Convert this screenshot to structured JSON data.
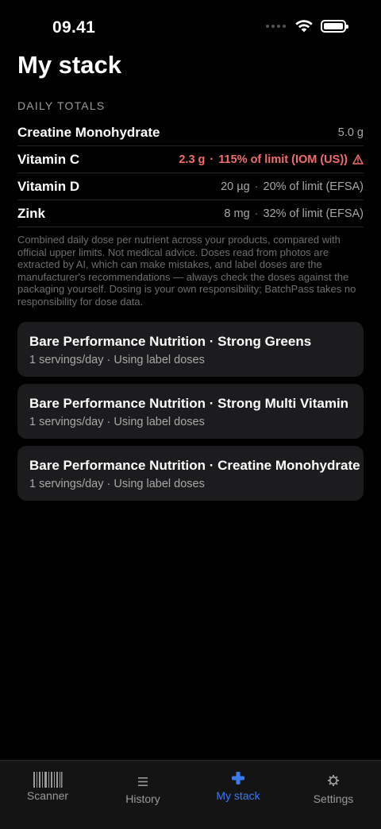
{
  "status_bar": {
    "time": "09.41"
  },
  "page": {
    "title": "My stack"
  },
  "daily_totals": {
    "label": "DAILY TOTALS",
    "rows": [
      {
        "name": "Creatine Monohydrate",
        "amount": "5.0 g",
        "limit": "",
        "over": false
      },
      {
        "name": "Vitamin C",
        "amount": "2.3 g",
        "limit": "115% of limit (IOM (US))",
        "over": true
      },
      {
        "name": "Vitamin D",
        "amount": "20 µg",
        "limit": "20% of limit (EFSA)",
        "over": false
      },
      {
        "name": "Zink",
        "amount": "8 mg",
        "limit": "32% of limit (EFSA)",
        "over": false
      }
    ],
    "separator": "·"
  },
  "disclaimer": "Combined daily dose per nutrient across your products, compared with official upper limits. Not medical advice. Doses read from photos are extracted by AI, which can make mistakes, and label doses are the manufacturer's recommendations — always check the doses against the packaging yourself. Dosing is your own responsibility; BatchPass takes no responsibility for dose data.",
  "products": [
    {
      "title": "Bare Performance Nutrition · Strong Greens",
      "subtitle": "1 servings/day · Using label doses"
    },
    {
      "title": "Bare Performance Nutrition · Strong Multi Vitamin",
      "subtitle": "1 servings/day · Using label doses"
    },
    {
      "title": "Bare Performance Nutrition · Creatine Monohydrate",
      "subtitle": "1 servings/day · Using label doses"
    }
  ],
  "tab_bar": {
    "tabs": [
      {
        "label": "Scanner",
        "icon": "barcode-icon",
        "active": false
      },
      {
        "label": "History",
        "icon": "list-icon",
        "active": false
      },
      {
        "label": "My stack",
        "icon": "plus-icon",
        "active": true
      },
      {
        "label": "Settings",
        "icon": "gear-icon",
        "active": false
      }
    ]
  },
  "colors": {
    "accent": "#3a7bf0",
    "warning": "#f26e6e",
    "card": "#1c1c1e",
    "background": "#000000"
  }
}
